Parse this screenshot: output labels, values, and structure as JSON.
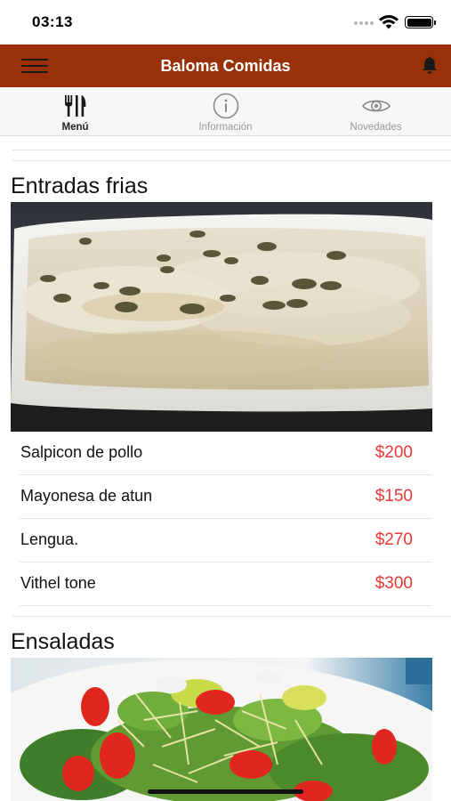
{
  "status_bar": {
    "time": "03:13"
  },
  "header": {
    "title": "Baloma Comidas",
    "icons": {
      "menu": "hamburger-menu-icon",
      "notifications": "bell-icon"
    },
    "colors": {
      "background": "#983008",
      "title": "#ffffff"
    }
  },
  "tabs": [
    {
      "label": "Menú",
      "icon": "fork-knife-icon",
      "active": true
    },
    {
      "label": "Información",
      "icon": "info-icon",
      "active": false
    },
    {
      "label": "Novedades",
      "icon": "eye-icon",
      "active": false
    }
  ],
  "sections": [
    {
      "title": "Entradas frias",
      "image": "vitel-tone-dish-photo",
      "items": [
        {
          "name": "Salpicon de pollo",
          "price": "$200"
        },
        {
          "name": "Mayonesa de atun",
          "price": "$150"
        },
        {
          "name": "Lengua.",
          "price": "$270"
        },
        {
          "name": "Vithel tone",
          "price": "$300"
        }
      ]
    },
    {
      "title": "Ensaladas",
      "image": "salad-dish-photo",
      "items": []
    }
  ],
  "colors": {
    "price": "#e53935",
    "accent": "#983008"
  }
}
